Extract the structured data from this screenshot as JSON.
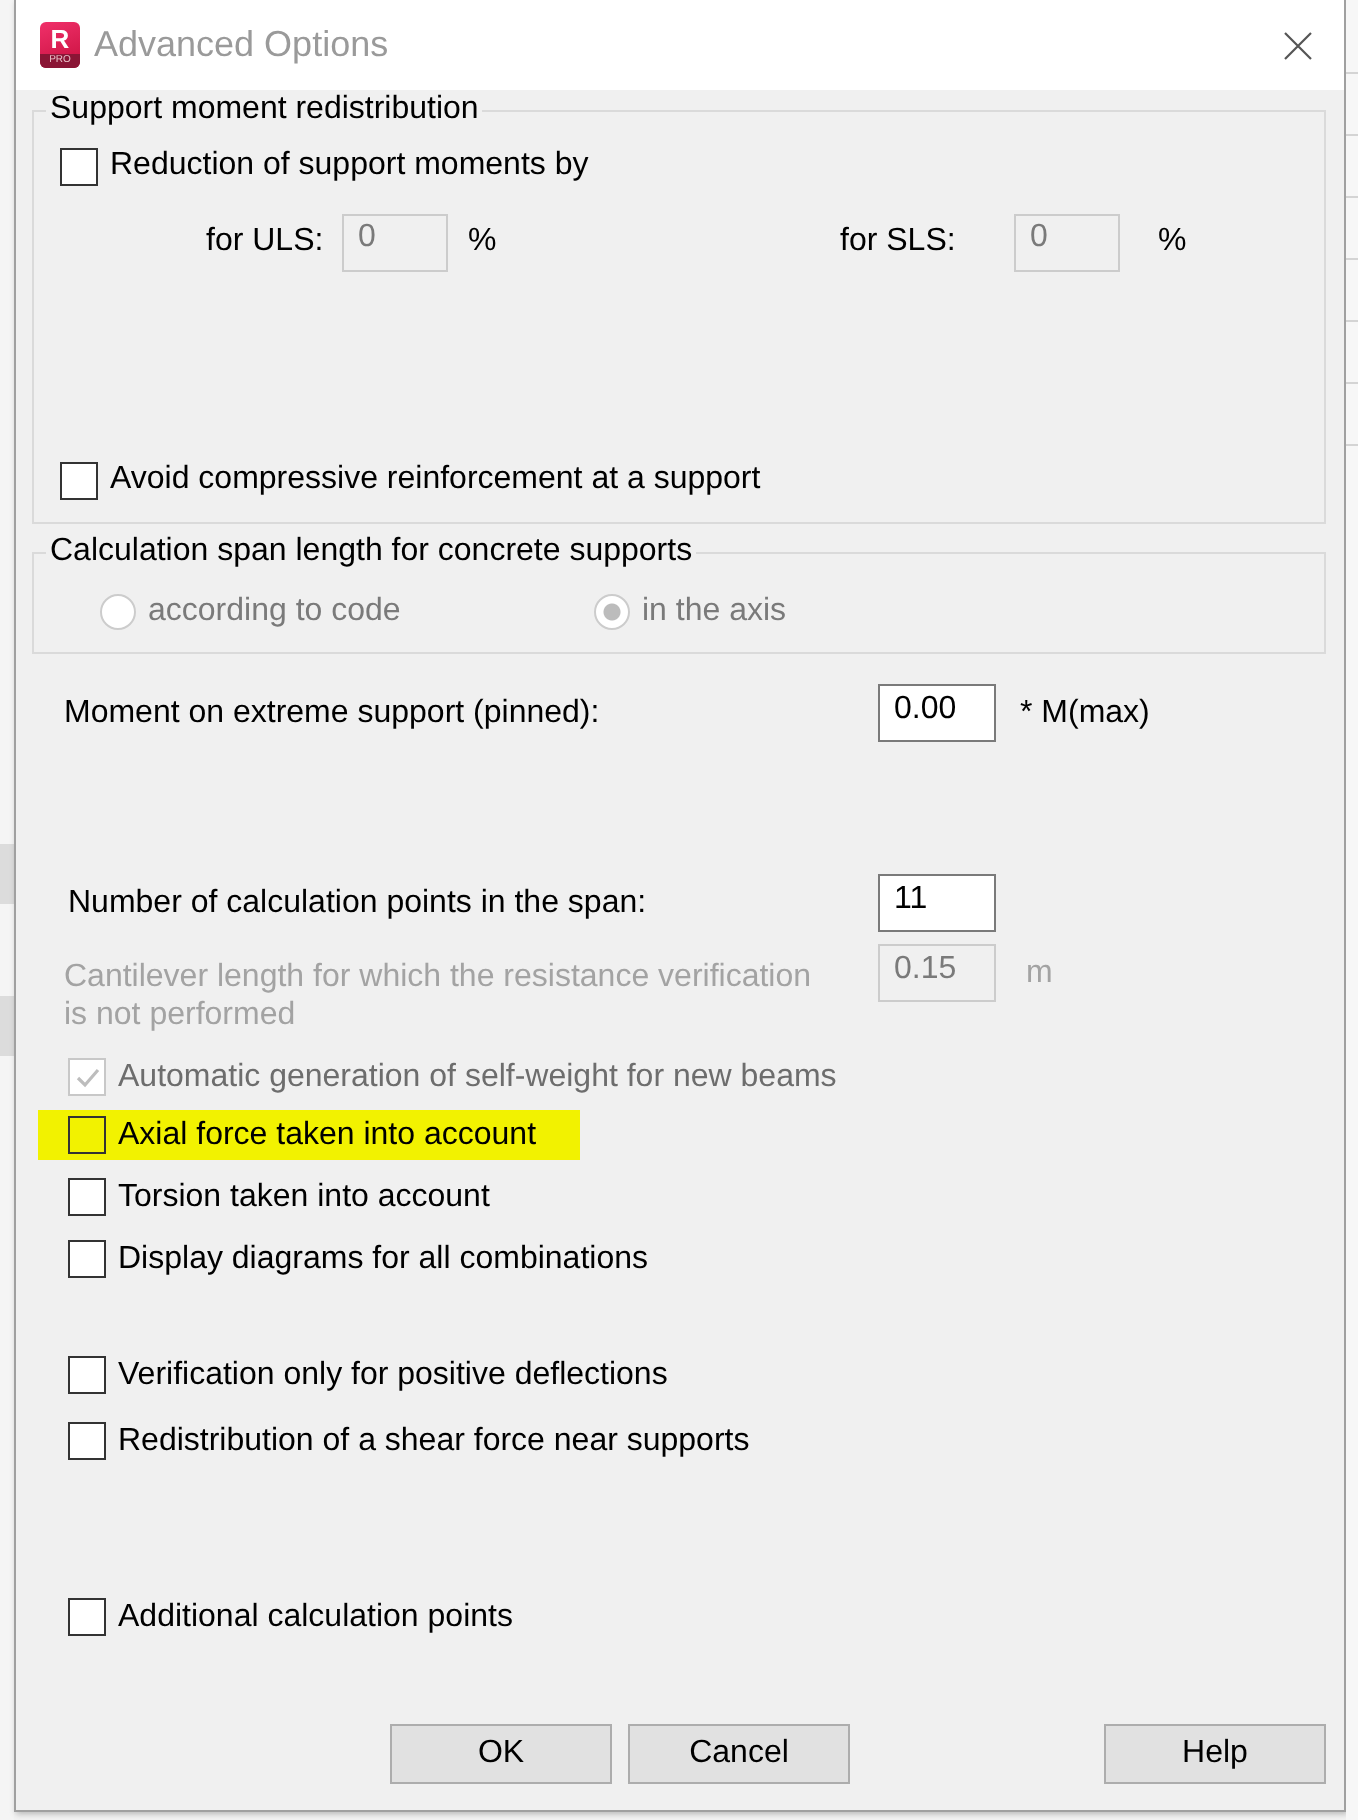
{
  "window": {
    "logo_letter": "R",
    "logo_badge": "PRO",
    "title": "Advanced Options"
  },
  "redistribution": {
    "title": "Support moment redistribution",
    "reduction": {
      "label": "Reduction of support moments by",
      "checked": false
    },
    "factors": [
      {
        "label": "for ULS:",
        "value": "0",
        "unit": "%",
        "disabled": true
      },
      {
        "label": "for SLS:",
        "value": "0",
        "unit": "%",
        "disabled": true
      }
    ],
    "avoid": {
      "label": "Avoid compressive reinforcement at a support",
      "checked": false
    }
  },
  "span_length": {
    "title": "Calculation span length for concrete supports",
    "options": [
      {
        "label": "according to code",
        "selected": false,
        "disabled": true
      },
      {
        "label": "in the axis",
        "selected": true,
        "disabled": true
      }
    ]
  },
  "moment": {
    "label": "Moment on extreme support (pinned):",
    "value": "0.00",
    "suffix": "* M(max)",
    "disabled": false
  },
  "points": {
    "label": "Number of calculation points in the span:",
    "value": "11",
    "disabled": false
  },
  "cantilever": {
    "label": "Cantilever length for which the resistance verification is not performed",
    "value": "0.15",
    "unit": "m",
    "disabled": true
  },
  "option_groups": [
    {
      "items": [
        {
          "label": "Automatic generation of self-weight for new beams",
          "checked": true,
          "disabled": true,
          "highlighted": false
        },
        {
          "label": "Axial force taken into account",
          "checked": false,
          "disabled": false,
          "highlighted": true
        },
        {
          "label": "Torsion taken into account",
          "checked": false,
          "disabled": false,
          "highlighted": false
        },
        {
          "label": "Display diagrams for all combinations",
          "checked": false,
          "disabled": false,
          "highlighted": false
        }
      ]
    },
    {
      "items": [
        {
          "label": "Verification only for positive deflections",
          "checked": false,
          "disabled": false,
          "highlighted": false
        },
        {
          "label": "Redistribution of a shear force near supports",
          "checked": false,
          "disabled": false,
          "highlighted": false
        }
      ]
    },
    {
      "items": [
        {
          "label": "Additional calculation points",
          "checked": false,
          "disabled": false,
          "highlighted": false
        }
      ]
    }
  ],
  "buttons": [
    {
      "label": "OK"
    },
    {
      "label": "Cancel"
    },
    {
      "label": "Help"
    }
  ]
}
